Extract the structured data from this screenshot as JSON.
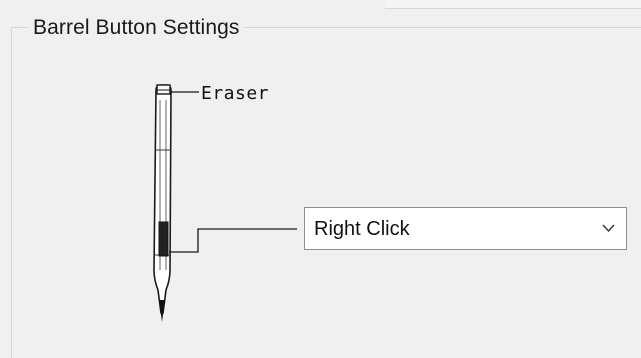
{
  "group": {
    "title": "Barrel Button Settings"
  },
  "pen": {
    "eraser_label": "Eraser",
    "icon": "stylus-pen"
  },
  "barrel_button": {
    "selected": "Right Click",
    "icon": "chevron-down"
  }
}
